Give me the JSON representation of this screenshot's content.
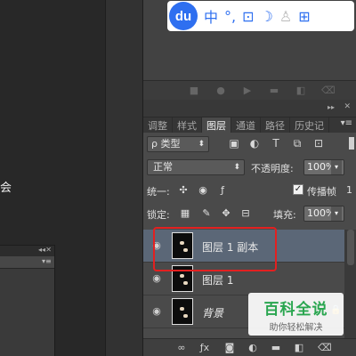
{
  "baidu_toolbar": {
    "logo": "du",
    "lang": "中",
    "punct": "°,",
    "tool": "⊡",
    "moon": "☽",
    "user": "♙",
    "grid": "⊞"
  },
  "canvas": {
    "glyph": "会"
  },
  "layers_panel": {
    "tabs": [
      {
        "label": "调整"
      },
      {
        "label": "样式"
      },
      {
        "label": "图层"
      },
      {
        "label": "通道"
      },
      {
        "label": "路径"
      },
      {
        "label": "历史记"
      }
    ],
    "filter": {
      "label": "ρ 类型"
    },
    "blend_mode": "正常",
    "opacity_label": "不透明度:",
    "opacity_value": "100%",
    "unify_label": "统一:",
    "propagate_label": "传播帧",
    "propagate_value": "1",
    "lock_label": "锁定:",
    "fill_label": "填充:",
    "fill_value": "100%",
    "layers": [
      {
        "name": "图层 1 副本",
        "selected": true
      },
      {
        "name": "图层 1",
        "selected": false
      },
      {
        "name": "背景",
        "selected": false
      }
    ]
  },
  "watermark": {
    "title": "百科全说",
    "subtitle": "助你轻松解决"
  },
  "colors": {
    "accent_blue": "#2e6ff0",
    "highlight_red": "#e32020",
    "watermark_green": "#2aa650",
    "selected_row": "#5b6777"
  }
}
